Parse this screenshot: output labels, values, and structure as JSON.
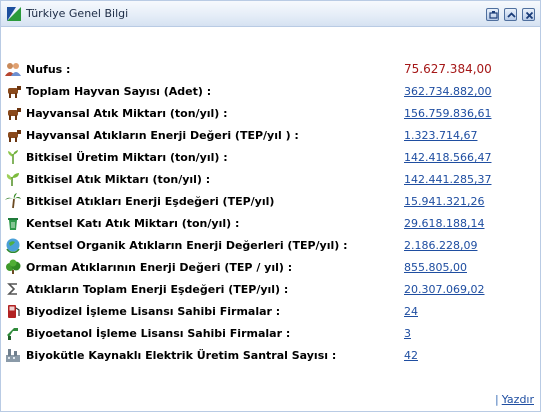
{
  "window": {
    "title": "Türkiye Genel Bilgi",
    "buttons": [
      "pin-icon",
      "collapse-icon",
      "close-icon"
    ]
  },
  "rows": [
    {
      "label": "Nufus :",
      "value": "75.627.384,00",
      "link": false,
      "icon": "people-icon"
    },
    {
      "label": "Toplam Hayvan Sayısı (Adet) :",
      "value": "362.734.882,00",
      "link": true,
      "icon": "cow-icon"
    },
    {
      "label": "Hayvansal Atık Miktarı (ton/yıl) :",
      "value": "156.759.836,61",
      "link": true,
      "icon": "cow-icon"
    },
    {
      "label": "Hayvansal Atıkların Enerji Değeri (TEP/yıl ) :",
      "value": "1.323.714,67",
      "link": true,
      "icon": "cow-icon"
    },
    {
      "label": "Bitkisel Üretim Miktarı (ton/yıl) :",
      "value": "142.418.566,47",
      "link": true,
      "icon": "sprout-icon"
    },
    {
      "label": "Bitkisel Atık Miktarı (ton/yıl) :",
      "value": "142.441.285,37",
      "link": true,
      "icon": "plant-icon"
    },
    {
      "label": "Bitkisel Atıkları Enerji Eşdeğeri (TEP/yıl)",
      "value": "15.941.321,26",
      "link": true,
      "icon": "palm-icon"
    },
    {
      "label": "Kentsel Katı Atık Miktarı (ton/yıl) :",
      "value": "29.618.188,14",
      "link": true,
      "icon": "recycle-bin-icon"
    },
    {
      "label": "Kentsel Organik Atıkların Enerji Değerleri (TEP/yıl) :",
      "value": "2.186.228,09",
      "link": true,
      "icon": "recycle-globe-icon"
    },
    {
      "label": "Orman Atıklarının Enerji Değeri (TEP / yıl) :",
      "value": "855.805,00",
      "link": true,
      "icon": "tree-icon"
    },
    {
      "label": "Atıkların Toplam Enerji Eşdeğeri (TEP/yıl) :",
      "value": "20.307.069,02",
      "link": true,
      "icon": "sigma-icon"
    },
    {
      "label": "Biyodizel İşleme Lisansı Sahibi Firmalar :",
      "value": "24",
      "link": true,
      "icon": "fuel-pump-icon"
    },
    {
      "label": "Biyoetanol İşleme Lisansı Sahibi Firmalar :",
      "value": "3",
      "link": true,
      "icon": "nozzle-icon"
    },
    {
      "label": "Biyokütle Kaynaklı Elektrik Üretim Santral Sayısı :",
      "value": "42",
      "link": true,
      "icon": "power-plant-icon"
    }
  ],
  "footer": {
    "print_label": "Yazdır"
  },
  "colors": {
    "link": "#1f4ea1",
    "population_value": "#a51818",
    "titlebar": "#dfe8f5",
    "border": "#b9cbe4"
  }
}
